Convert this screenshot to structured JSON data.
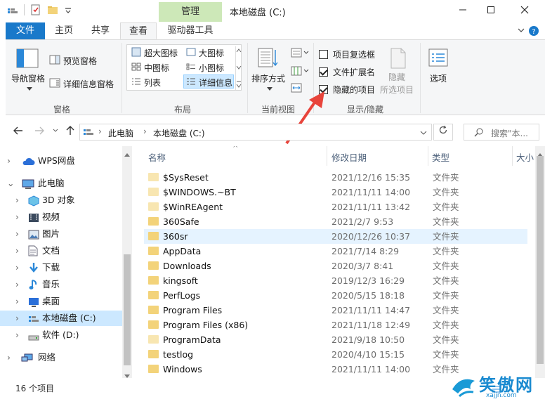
{
  "window": {
    "title": "本地磁盘 (C:)",
    "contextual_tab": "管理"
  },
  "tabs": [
    {
      "label": "文件"
    },
    {
      "label": "主页"
    },
    {
      "label": "共享"
    },
    {
      "label": "查看"
    },
    {
      "label": "驱动器工具"
    }
  ],
  "ribbon": {
    "panes": {
      "nav_pane": "导航窗格",
      "preview_pane": "预览窗格",
      "details_pane": "详细信息窗格",
      "group": "窗格"
    },
    "layout": {
      "extra_large": "超大图标",
      "large": "大图标",
      "medium": "中图标",
      "small": "小图标",
      "list": "列表",
      "details": "详细信息",
      "group": "布局"
    },
    "current_view": {
      "sort_by": "排序方式",
      "group": "当前视图"
    },
    "show_hide": {
      "item_checkboxes": "项目复选框",
      "item_checkboxes_checked": false,
      "file_extensions": "文件扩展名",
      "file_extensions_checked": true,
      "hidden_items": "隐藏的项目",
      "hidden_items_checked": true,
      "hide_selected_line1": "隐藏",
      "hide_selected_line2": "所选项目",
      "group": "显示/隐藏"
    },
    "options": "选项"
  },
  "address": {
    "crumbs": [
      "此电脑",
      "本地磁盘 (C:)"
    ],
    "search_placeholder": "搜索\"本..."
  },
  "nav_pane": [
    {
      "label": "WPS网盘",
      "icon": "cloud-icon"
    },
    {
      "label": "此电脑",
      "icon": "computer-icon"
    },
    {
      "label": "3D 对象",
      "icon": "cube-icon"
    },
    {
      "label": "视频",
      "icon": "video-icon"
    },
    {
      "label": "图片",
      "icon": "picture-icon"
    },
    {
      "label": "文档",
      "icon": "document-icon"
    },
    {
      "label": "下载",
      "icon": "download-icon"
    },
    {
      "label": "音乐",
      "icon": "music-icon"
    },
    {
      "label": "桌面",
      "icon": "desktop-icon"
    },
    {
      "label": "本地磁盘 (C:)",
      "icon": "drive-icon"
    },
    {
      "label": "软件 (D:)",
      "icon": "drive-icon"
    },
    {
      "label": "网络",
      "icon": "network-icon"
    }
  ],
  "columns": {
    "name": "名称",
    "date": "修改日期",
    "type": "类型",
    "size": "大小"
  },
  "files": [
    {
      "name": "$SysReset",
      "date": "2021/12/16 15:35",
      "type": "文件夹"
    },
    {
      "name": "$WINDOWS.~BT",
      "date": "2021/11/11 14:00",
      "type": "文件夹"
    },
    {
      "name": "$WinREAgent",
      "date": "2021/11/11 13:42",
      "type": "文件夹"
    },
    {
      "name": "360Safe",
      "date": "2021/2/7 9:53",
      "type": "文件夹"
    },
    {
      "name": "360sr",
      "date": "2020/12/26 10:37",
      "type": "文件夹"
    },
    {
      "name": "AppData",
      "date": "2021/7/14 8:29",
      "type": "文件夹"
    },
    {
      "name": "Downloads",
      "date": "2020/3/7 8:41",
      "type": "文件夹"
    },
    {
      "name": "kingsoft",
      "date": "2019/12/3 16:29",
      "type": "文件夹"
    },
    {
      "name": "PerfLogs",
      "date": "2020/5/15 18:18",
      "type": "文件夹"
    },
    {
      "name": "Program Files",
      "date": "2021/11/11 14:47",
      "type": "文件夹"
    },
    {
      "name": "Program Files (x86)",
      "date": "2021/11/18 12:49",
      "type": "文件夹"
    },
    {
      "name": "ProgramData",
      "date": "2021/9/18 10:50",
      "type": "文件夹"
    },
    {
      "name": "testlog",
      "date": "2020/4/10 15:15",
      "type": "文件夹"
    },
    {
      "name": "Windows",
      "date": "2021/11/11 14:00",
      "type": "文件夹"
    }
  ],
  "status": {
    "count": "16 个项目"
  },
  "watermark": {
    "text": "笑傲网",
    "sub": "xajjn.com"
  },
  "colors": {
    "accent": "#1979ca",
    "manage_tab": "#cde8b8",
    "selection": "#cce8ff",
    "arrow": "#e8443b"
  }
}
